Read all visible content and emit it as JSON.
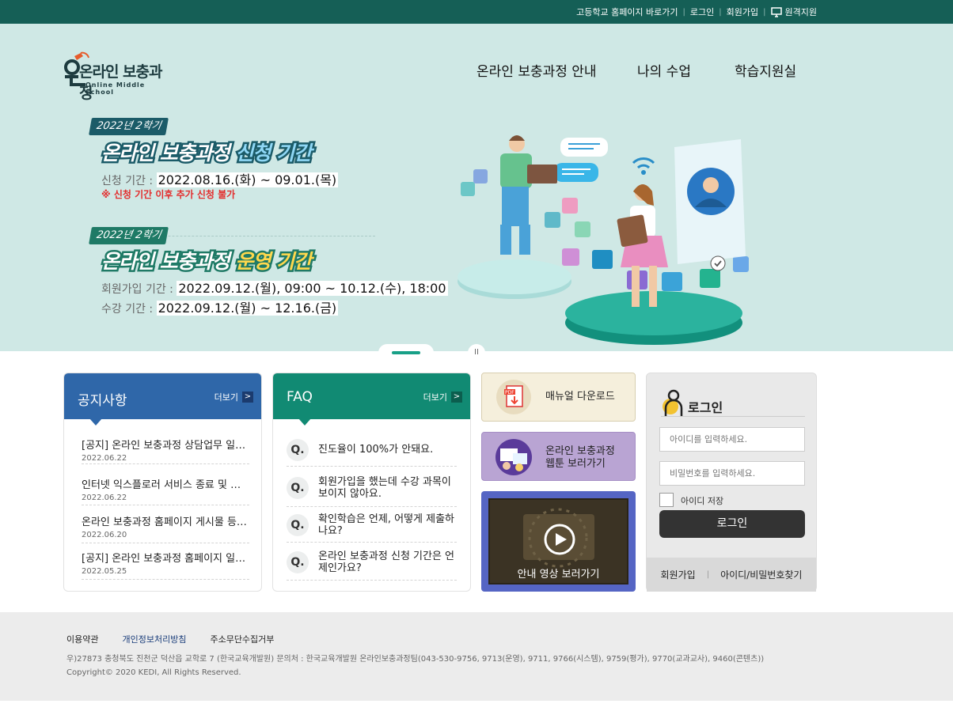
{
  "topbar": {
    "links": [
      "고등학교 홈페이지 바로가기",
      "로그인",
      "회원가입"
    ],
    "remote_label": "원격지원"
  },
  "logo": {
    "main": "온라인 보충과정",
    "sub": "Online Middle School"
  },
  "nav": [
    "온라인 보충과정 안내",
    "나의 수업",
    "학습지원실"
  ],
  "hero": {
    "slide1": {
      "badge": "2022년 2학기",
      "headline_a": "온라인 보충과정 ",
      "headline_b": "신청 기간",
      "label": "신청 기간 :",
      "period": "2022.08.16.(화) ~ 09.01.(목)",
      "warning": "※ 신청 기간 이후 추가 신청 불가"
    },
    "slide2": {
      "badge": "2022년 2학기",
      "headline_a": "온라인 보충과정 ",
      "headline_b": "운영 기간",
      "join_label": "회원가입 기간 :",
      "join_period": "2022.09.12.(월), 09:00 ~ 10.12.(수), 18:00",
      "study_label": "수강 기간 :",
      "study_period": "2022.09.12.(월) ~ 12.16.(금)"
    },
    "pause_symbol": "II"
  },
  "notice": {
    "title": "공지사항",
    "more": "더보기",
    "items": [
      {
        "title": "[공지] 온라인 보충과정 상담업무 일시…",
        "date": "2022.06.22"
      },
      {
        "title": "인터넷 익스플로러 서비스 종료 및 권…",
        "date": "2022.06.22"
      },
      {
        "title": "온라인 보충과정 홈페이지 게시물 등…",
        "date": "2022.06.20"
      },
      {
        "title": "[공지] 온라인 보충과정 홈페이지 일시…",
        "date": "2022.05.25"
      }
    ]
  },
  "faq": {
    "title": "FAQ",
    "more": "더보기",
    "q_mark": "Q.",
    "items": [
      "진도율이 100%가 안돼요.",
      "회원가입을 했는데 수강 과목이 보이지 않아요.",
      "확인학습은 언제, 어떻게 제출하나요?",
      "온라인 보충과정 신청 기간은 언제인가요?"
    ]
  },
  "quick": {
    "manual": "매뉴얼 다운로드",
    "webtoon_1": "온라인 보충과정",
    "webtoon_2": "웹툰 보러가기",
    "video": "안내 영상 보러가기",
    "pdf_text": "PDF"
  },
  "login": {
    "title": "로그인",
    "id_placeholder": "아이디를 입력하세요.",
    "pw_placeholder": "비밀번호를 입력하세요.",
    "save_id": "아이디 저장",
    "button": "로그인",
    "join": "회원가입",
    "find": "아이디/비밀번호찾기",
    "sep": "|"
  },
  "footer": {
    "terms": "이용약관",
    "privacy": "개인정보처리방침",
    "email_refuse": "주소무단수집거부",
    "address": "우)27873 충청북도 진천군 덕산읍 교학로 7 (한국교육개발원)     문의처 : 한국교육개발원 온라인보충과정팀(043-530-9756, 9713(운영), 9711, 9766(시스템), 9759(평가), 9770(교과교사), 9460(콘텐츠))",
    "copyright": "Copyright© 2020 KEDI, All Rights Reserved."
  },
  "colors": {
    "topbar": "#155f56",
    "hero_bg": "#cfe8e5",
    "notice_head": "#2f67a9",
    "faq_head": "#118a73",
    "manual_bg": "#f5efdc",
    "webtoon_bg": "#b9a4d3",
    "video_bg": "#5565c4"
  }
}
